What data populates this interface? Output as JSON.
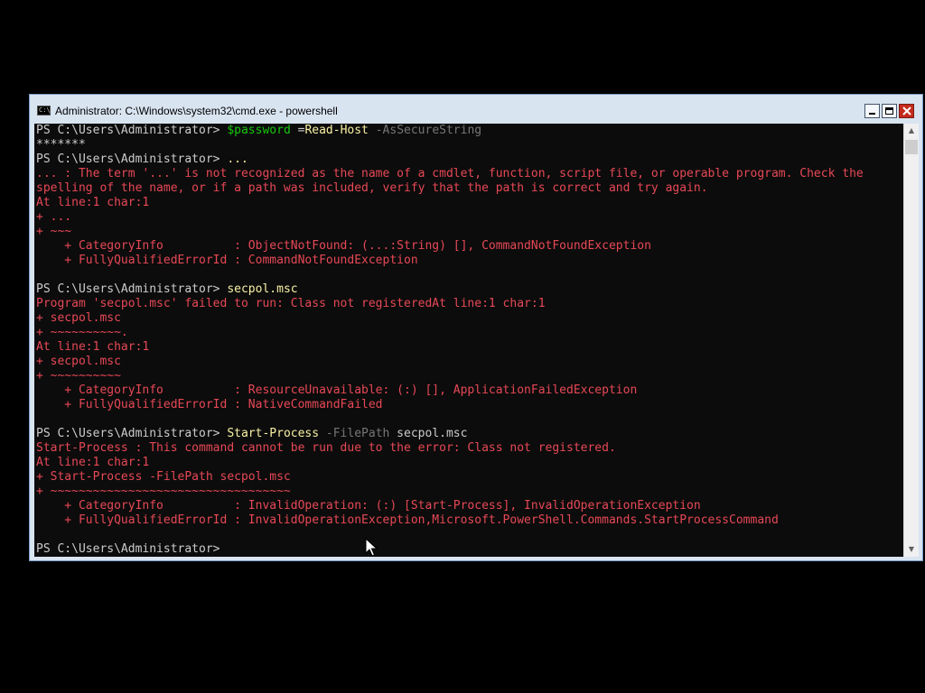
{
  "window": {
    "title": "Administrator: C:\\Windows\\system32\\cmd.exe - powershell",
    "icon": "cmd-icon",
    "icon_text": "C:\\"
  },
  "console": {
    "lines": [
      [
        {
          "t": "PS C:\\Users\\Administrator> ",
          "c": "w"
        },
        {
          "t": "$password",
          "c": "gr"
        },
        {
          "t": " =",
          "c": "w"
        },
        {
          "t": "Read-Host",
          "c": "y"
        },
        {
          "t": " -AsSecureString",
          "c": "g"
        }
      ],
      [
        {
          "t": "*******",
          "c": "w"
        }
      ],
      [
        {
          "t": "PS C:\\Users\\Administrator> ",
          "c": "w"
        },
        {
          "t": "...",
          "c": "y"
        }
      ],
      [
        {
          "t": "... : The term '...' is not recognized as the name of a cmdlet, function, script file, or operable program. Check the",
          "c": "r"
        }
      ],
      [
        {
          "t": "spelling of the name, or if a path was included, verify that the path is correct and try again.",
          "c": "r"
        }
      ],
      [
        {
          "t": "At line:1 char:1",
          "c": "r"
        }
      ],
      [
        {
          "t": "+ ...",
          "c": "r"
        }
      ],
      [
        {
          "t": "+ ~~~",
          "c": "r"
        }
      ],
      [
        {
          "t": "    + CategoryInfo          : ObjectNotFound: (...:String) [], CommandNotFoundException",
          "c": "r"
        }
      ],
      [
        {
          "t": "    + FullyQualifiedErrorId : CommandNotFoundException",
          "c": "r"
        }
      ],
      [
        {
          "t": "",
          "c": "w"
        }
      ],
      [
        {
          "t": "PS C:\\Users\\Administrator> ",
          "c": "w"
        },
        {
          "t": "secpol.msc",
          "c": "y"
        }
      ],
      [
        {
          "t": "Program 'secpol.msc' failed to run: Class not registeredAt line:1 char:1",
          "c": "r"
        }
      ],
      [
        {
          "t": "+ secpol.msc",
          "c": "r"
        }
      ],
      [
        {
          "t": "+ ~~~~~~~~~~.",
          "c": "r"
        }
      ],
      [
        {
          "t": "At line:1 char:1",
          "c": "r"
        }
      ],
      [
        {
          "t": "+ secpol.msc",
          "c": "r"
        }
      ],
      [
        {
          "t": "+ ~~~~~~~~~~",
          "c": "r"
        }
      ],
      [
        {
          "t": "    + CategoryInfo          : ResourceUnavailable: (:) [], ApplicationFailedException",
          "c": "r"
        }
      ],
      [
        {
          "t": "    + FullyQualifiedErrorId : NativeCommandFailed",
          "c": "r"
        }
      ],
      [
        {
          "t": "",
          "c": "w"
        }
      ],
      [
        {
          "t": "PS C:\\Users\\Administrator> ",
          "c": "w"
        },
        {
          "t": "Start-Process",
          "c": "y"
        },
        {
          "t": " -FilePath",
          "c": "g"
        },
        {
          "t": " secpol.msc",
          "c": "w"
        }
      ],
      [
        {
          "t": "Start-Process : This command cannot be run due to the error: Class not registered.",
          "c": "r"
        }
      ],
      [
        {
          "t": "At line:1 char:1",
          "c": "r"
        }
      ],
      [
        {
          "t": "+ Start-Process -FilePath secpol.msc",
          "c": "r"
        }
      ],
      [
        {
          "t": "+ ~~~~~~~~~~~~~~~~~~~~~~~~~~~~~~~~~~",
          "c": "r"
        }
      ],
      [
        {
          "t": "    + CategoryInfo          : InvalidOperation: (:) [Start-Process], InvalidOperationException",
          "c": "r"
        }
      ],
      [
        {
          "t": "    + FullyQualifiedErrorId : InvalidOperationException,Microsoft.PowerShell.Commands.StartProcessCommand",
          "c": "r"
        }
      ],
      [
        {
          "t": "",
          "c": "w"
        }
      ],
      [
        {
          "t": "PS C:\\Users\\Administrator>",
          "c": "w"
        }
      ]
    ]
  },
  "colors": {
    "background": "#0c0c0c",
    "text": "#cccccc",
    "error": "#e74856",
    "command": "#f9f1a5",
    "parameter": "#767676",
    "variable": "#16c60c",
    "titlebar": "#d9e4f1"
  },
  "scrollbar": {
    "up_icon": "scroll-up-arrow-icon",
    "down_icon": "scroll-down-arrow-icon"
  }
}
